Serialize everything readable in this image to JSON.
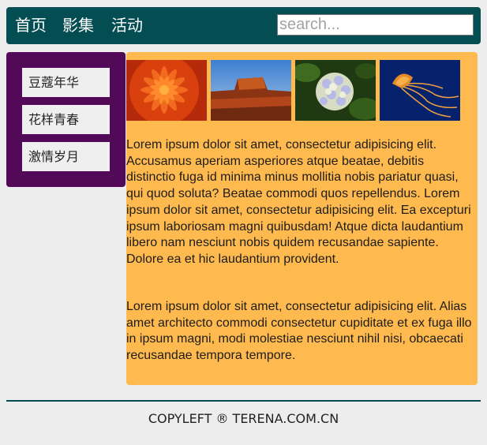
{
  "header": {
    "nav": [
      "首页",
      "影集",
      "活动"
    ],
    "search_placeholder": "search..."
  },
  "sidebar": {
    "items": [
      "豆蔻年华",
      "花样青春",
      "激情岁月"
    ]
  },
  "gallery": {
    "images": [
      "red-flower-image",
      "desert-mesa-image",
      "hydrangea-image",
      "jellyfish-image"
    ]
  },
  "main": {
    "paragraphs": [
      "Lorem ipsum dolor sit amet, consectetur adipisicing elit. Accusamus aperiam asperiores atque beatae, debitis distinctio fuga id minima minus mollitia nobis pariatur quasi, qui quod soluta? Beatae commodi quos repellendus. Lorem ipsum dolor sit amet, consectetur adipisicing elit. Ea excepturi ipsum laboriosam magni quibusdam! Atque dicta laudantium libero nam nesciunt nobis quidem recusandae sapiente. Dolore ea et hic laudantium provident.",
      "Lorem ipsum dolor sit amet, consectetur adipisicing elit. Alias amet architecto commodi consectetur cupiditate et ex fuga illo in ipsum magni, modi molestiae nesciunt nihil nisi, obcaecati recusandae tempora tempore."
    ]
  },
  "footer": {
    "text": "COPYLEFT ® TERENA.COM.CN"
  },
  "colors": {
    "header_bg": "#044d52",
    "sidebar_bg": "#520a58",
    "content_bg": "#feb94f",
    "page_bg": "#ededed"
  }
}
